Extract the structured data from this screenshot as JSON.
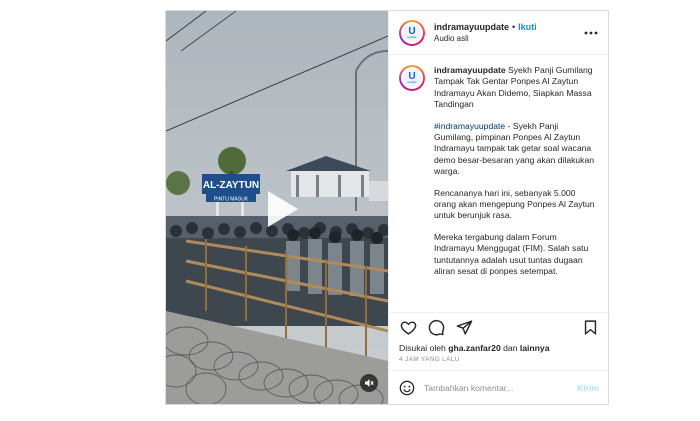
{
  "header": {
    "username": "indramayuupdate",
    "separator": "•",
    "follow_label": "Ikuti",
    "audio_label": "Audio asli",
    "more_icon": "more-horizontal-icon"
  },
  "caption": {
    "username": "indramayuupdate",
    "headline": "Syekh Panji Gumilang Tampak Tak Gentar Ponpes Al Zaytun Indramayu Akan Didemo, Siapkan Massa Tandingan",
    "hashtag": "#indramayuupdate",
    "para1_rest": " - Syekh Panji Gumilang, pimpinan Ponpes Al Zaytun Indramayu tampak tak getar soal wacana demo besar-besaran yang akan dilakukan warga.",
    "para2": "Rencananya hari ini, sebanyak 5.000 orang akan mengepung Ponpes Al Zaytun untuk berunjuk rasa.",
    "para3": "Mereka tergabung dalam Forum Indramayu Menggugat (FIM). Salah satu tuntutannya adalah usut tuntas dugaan aliran sesat di ponpes setempat."
  },
  "avatar": {
    "letter": "U",
    "sub": "update"
  },
  "media": {
    "sign_title": "AL-ZAYTUN",
    "sign_sub": "PINTU MASUK"
  },
  "actions": {
    "icons": [
      "heart-icon",
      "comment-icon",
      "share-icon",
      "bookmark-icon"
    ]
  },
  "likes": {
    "prefix": "Disukai oleh ",
    "user": "gha.zanfar20",
    "middle": " dan ",
    "others": "lainnya"
  },
  "timestamp": "4 JAM YANG LALU",
  "comment_box": {
    "placeholder": "Tambahkan komentar...",
    "post_label": "Kirim"
  },
  "colors": {
    "accent": "#0095f6",
    "post_disabled": "#b2dffc",
    "hashtag": "#00376b",
    "muted": "#8e8e8e"
  }
}
